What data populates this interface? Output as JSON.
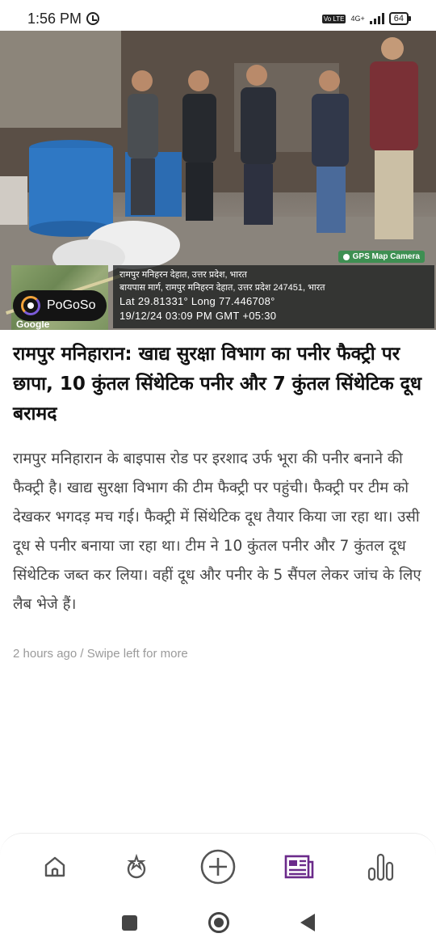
{
  "status_bar": {
    "time": "1:56 PM",
    "network_badge": "Vo LTE",
    "network_type": "4G+",
    "battery": "64",
    "icons": [
      "alarm-icon",
      "signal-icon",
      "battery-icon"
    ]
  },
  "hero": {
    "gps_camera_label": "GPS Map Camera",
    "location_line_1": "रामपुर मनिहरन देहात, उत्तर प्रदेश, भारत",
    "location_line_2": "बायपास मार्ग, रामपुर मनिहरन देहात, उत्तर प्रदेश 247451, भारत",
    "coords": "Lat 29.81331° Long 77.446708°",
    "datetime": "19/12/24 03:09 PM GMT +05:30",
    "map_attribution": "Google",
    "brand_pill": "PoGoSo"
  },
  "article": {
    "headline": "रामपुर मनिहारान: खाद्य सुरक्षा विभाग का पनीर फैक्ट्री पर छापा, 10 कुंतल सिंथेटिक पनीर और 7 कुंतल सिंथेटिक दूध बरामद",
    "body": "रामपुर मनिहारान के बाइपास रोड पर इरशाद उर्फ भूरा की पनीर बनाने की फैक्ट्री है। खाद्य सुरक्षा विभाग की टीम फैक्ट्री पर पहुंची। फैक्ट्री पर टीम को देखकर भगदड़ मच गई। फैक्ट्री में सिंथेटिक दूध तैयार किया जा रहा था। उसी दूध से पनीर बनाया जा रहा था। टीम ने 10 कुंतल पनीर और 7 कुंतल दूध सिंथेटिक जब्त कर लिया। वहीं दूध और पनीर के 5 सैंपल लेकर जांच के लिए लैब भेजे हैं।",
    "meta": "2 hours ago / Swipe left for more"
  },
  "bottom_nav": {
    "items": [
      "home-icon",
      "trending-icon",
      "add-icon",
      "news-icon",
      "stats-icon"
    ],
    "active_color": "#6b2a8a",
    "inactive_color": "#555555"
  },
  "system_nav": [
    "recents-icon",
    "home-circle-icon",
    "back-icon"
  ]
}
